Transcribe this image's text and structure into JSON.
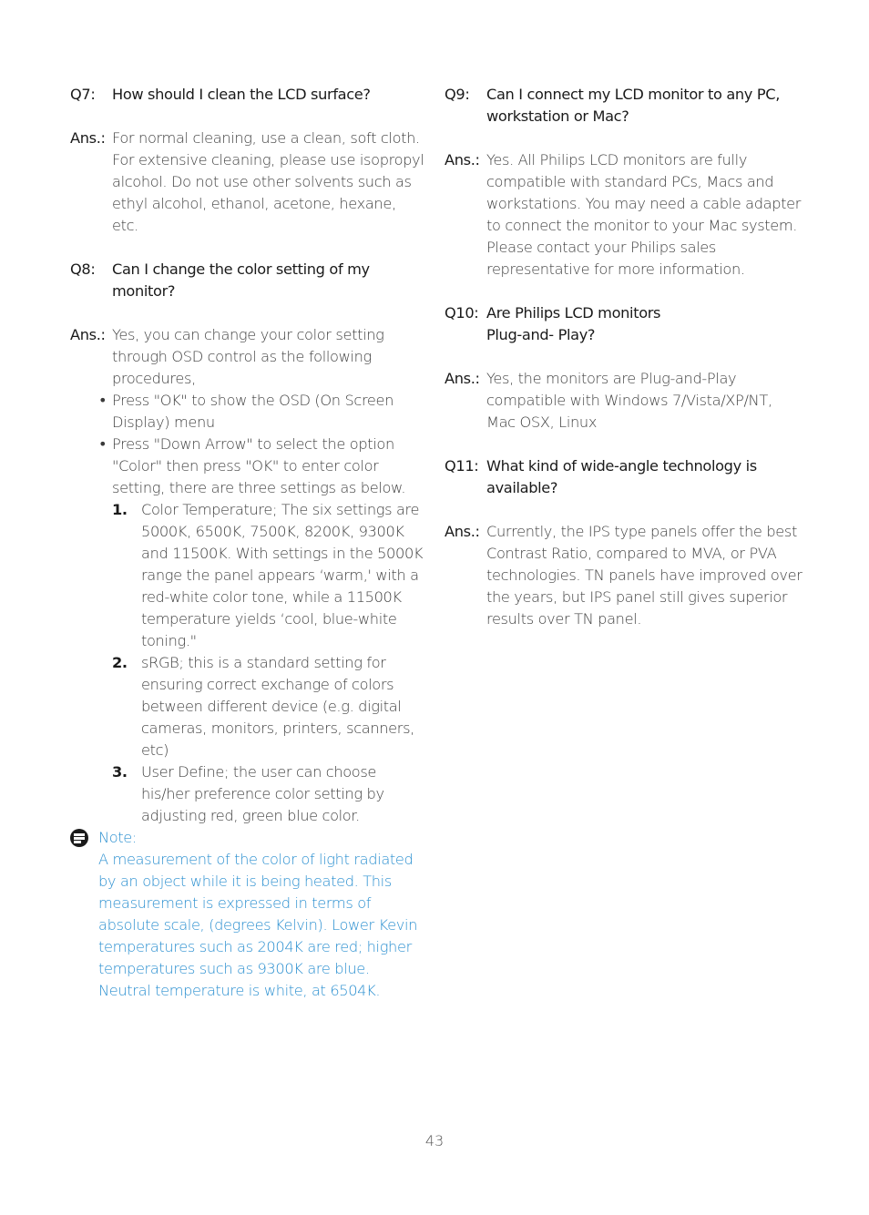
{
  "left_column": {
    "q7": {
      "tag": "Q7:",
      "question": "How should I clean the LCD surface?",
      "answer_tag": "Ans.:",
      "answer": "For normal cleaning, use a clean, soft cloth. For extensive cleaning, please use isopropyl alcohol. Do not use other solvents such as ethyl alcohol, ethanol, acetone, hexane, etc."
    },
    "q8": {
      "tag": "Q8:",
      "question": "Can I change the color setting of my monitor?",
      "answer_tag": "Ans.:",
      "answer": "Yes, you can change your color setting through OSD control as the following procedures,",
      "bullets": [
        "Press \"OK\" to show the OSD (On Screen Display) menu",
        "Press \"Down Arrow\" to select the option \"Color\" then press \"OK\" to enter color setting, there are three settings as below."
      ],
      "numbered": [
        {
          "num": "1.",
          "text": "Color Temperature; The six settings are 5000K, 6500K, 7500K, 8200K, 9300K and 11500K. With settings in the 5000K range the panel appears ‘warm,' with a red-white color tone, while a 11500K temperature yields ‘cool, blue-white toning.\""
        },
        {
          "num": "2.",
          "text": "sRGB; this is a standard setting for ensuring correct exchange of colors between different device (e.g. digital cameras, monitors, printers, scanners, etc)"
        },
        {
          "num": "3.",
          "text": "User Define; the user can choose his/her preference color setting by adjusting red, green blue color."
        }
      ]
    },
    "note": {
      "icon": "note-icon",
      "label": "Note:",
      "text": "A measurement of the color of light radiated by an object while it is being heated. This measurement is expressed in terms of absolute scale, (degrees Kelvin). Lower Kevin temperatures such as 2004K are red; higher temperatures such as 9300K are blue. Neutral temperature is white, at 6504K.",
      "color": "#2a8fd0"
    }
  },
  "right_column": {
    "q9": {
      "tag": "Q9:",
      "question": "Can I connect my LCD monitor to any PC, workstation or Mac?",
      "answer_tag": "Ans.:",
      "answer": "Yes. All Philips LCD monitors are fully compatible with standard PCs, Macs and workstations. You may need a cable adapter to connect the monitor to your Mac system. Please contact your Philips sales representative for more information."
    },
    "q10": {
      "tag": "Q10:",
      "question": "Are Philips LCD monitors Plug-and- Play?",
      "answer_tag": "Ans.:",
      "answer": "Yes, the monitors are Plug-and-Play compatible with Windows 7/Vista/XP/NT, Mac OSX, Linux"
    },
    "q11": {
      "tag": "Q11:",
      "question": "What kind of wide-angle technology is available?",
      "answer_tag": "Ans.:",
      "answer": "Currently, the IPS type panels offer the best Contrast Ratio, compared to MVA, or PVA technologies. TN panels have improved over the years, but IPS panel still gives superior results over TN panel."
    }
  },
  "page_number": "43"
}
